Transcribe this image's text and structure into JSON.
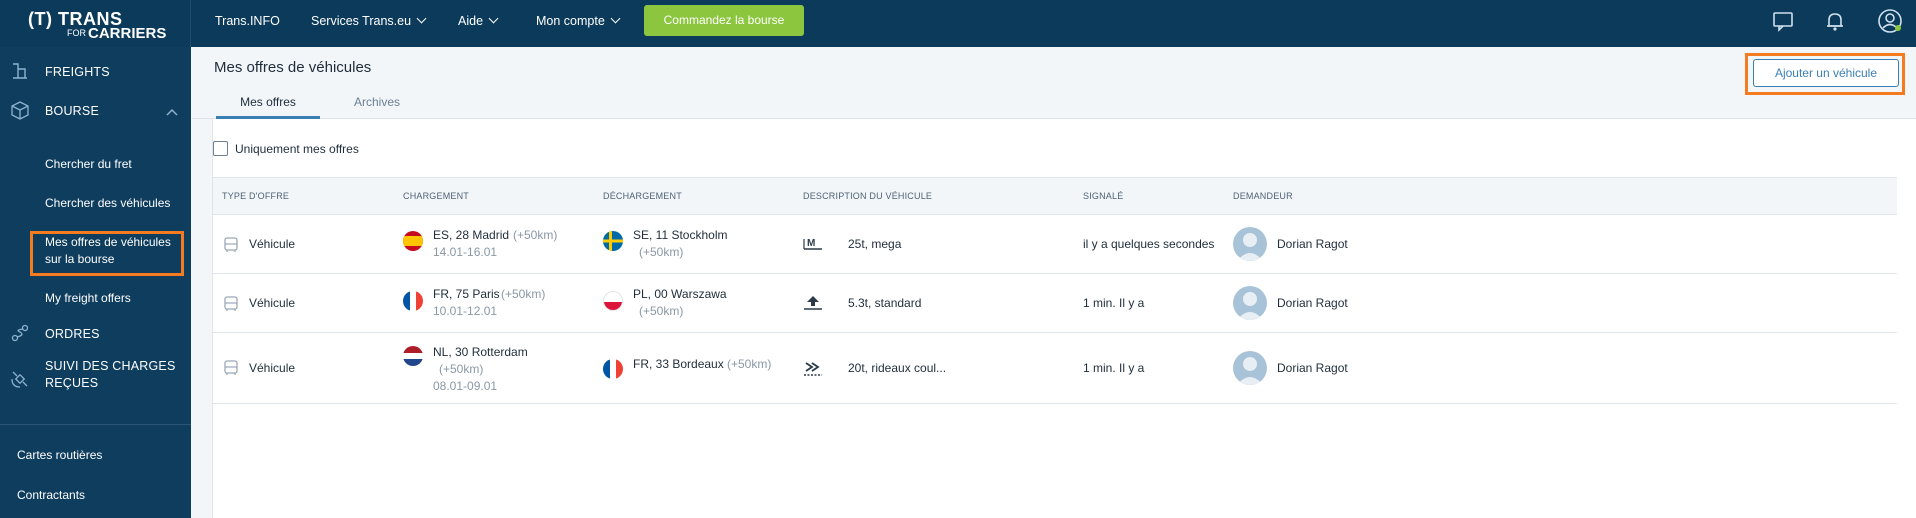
{
  "logo": {
    "line1": "(T) TRANS",
    "line2": "FOR",
    "line3": "CARRIERS"
  },
  "topnav": {
    "items": [
      {
        "label": "Trans.INFO"
      },
      {
        "label": "Services Trans.eu"
      },
      {
        "label": "Aide"
      },
      {
        "label": "Mon compte"
      }
    ],
    "cta_label": "Commandez la bourse"
  },
  "sidebar": {
    "freights": "FREIGHTS",
    "bourse": "BOURSE",
    "sub": [
      "Chercher du fret",
      "Chercher des véhicules",
      "Mes offres de véhicules",
      "sur la bourse",
      "My freight offers"
    ],
    "ordres": "ORDRES",
    "suivi_line1": "SUIVI DES CHARGES",
    "suivi_line2": "REÇUES",
    "cartes": "Cartes routières",
    "contractants": "Contractants"
  },
  "page": {
    "title": "Mes offres de véhicules",
    "tabs": [
      "Mes offres",
      "Archives"
    ],
    "add_button": "Ajouter un véhicule",
    "only_mine_label": "Uniquement mes offres"
  },
  "table": {
    "headers": [
      "TYPE D'OFFRE",
      "CHARGEMENT",
      "DÉCHARGEMENT",
      "DESCRIPTION DU VÉHICULE",
      "SIGNALÉ",
      "DEMANDEUR"
    ],
    "rows": [
      {
        "type": "Véhicule",
        "load_place": "ES, 28 Madrid",
        "load_radius": "(+50km)",
        "load_date": "14.01-16.01",
        "unload_place": "SE, 11 Stockholm",
        "unload_radius": "(+50km)",
        "vehicle": "25t, mega",
        "reported": "il y a quelques secondes",
        "requester": "Dorian Ragot"
      },
      {
        "type": "Véhicule",
        "load_place": "FR, 75 Paris",
        "load_radius": "(+50km)",
        "load_date": "10.01-12.01",
        "unload_place": "PL, 00 Warszawa",
        "unload_radius": "(+50km)",
        "vehicle": "5.3t, standard",
        "reported": "1 min. Il y a",
        "requester": "Dorian Ragot"
      },
      {
        "type": "Véhicule",
        "load_place": "NL, 30 Rotterdam",
        "load_radius": "(+50km)",
        "load_date": "08.01-09.01",
        "unload_place": "FR, 33 Bordeaux",
        "unload_radius": "(+50km)",
        "vehicle": "20t, rideaux coul...",
        "reported": "1 min. Il y a",
        "requester": "Dorian Ragot"
      }
    ]
  },
  "colors": {
    "nav": "#0c3a5a",
    "accent": "#3a7fb4",
    "cta": "#8cc63f",
    "highlight": "#f47b20"
  },
  "icons": [
    "chat-icon",
    "bell-icon",
    "user-icon",
    "truck-icon",
    "box-icon",
    "route-icon",
    "satellite-icon",
    "bus-icon",
    "mega-icon",
    "standard-icon",
    "curtain-icon"
  ]
}
